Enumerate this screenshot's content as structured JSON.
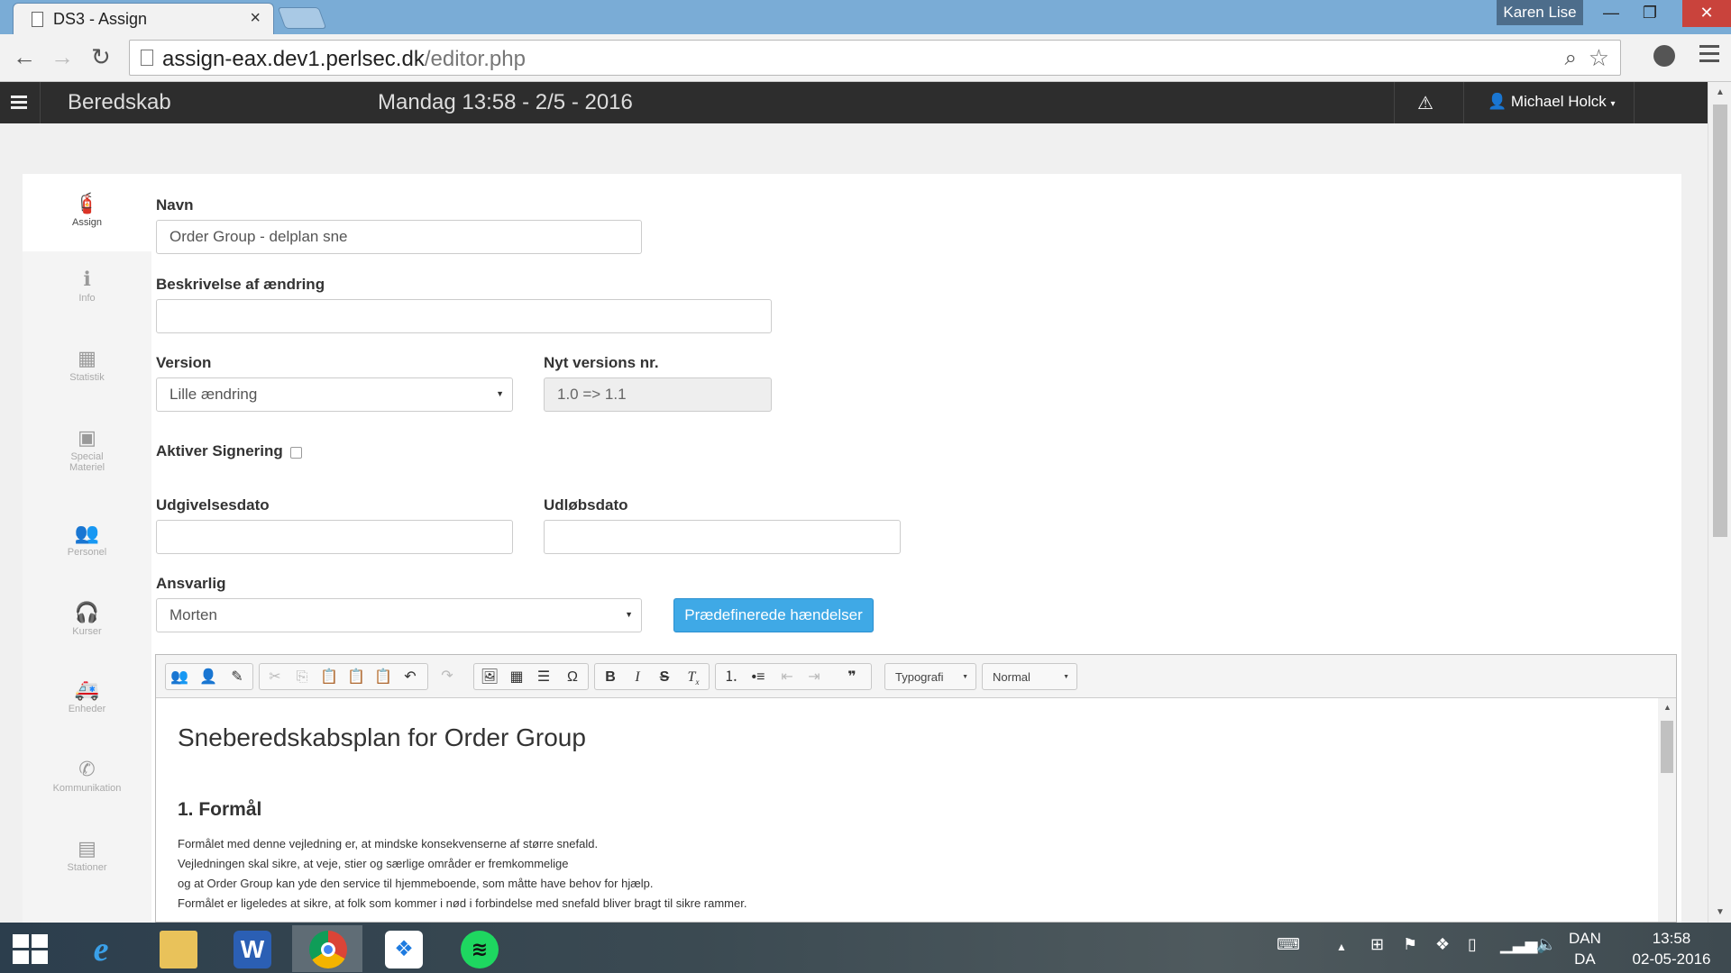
{
  "browser": {
    "tab_title": "DS3 - Assign",
    "tab_close": "×",
    "profile_name": "Karen Lise",
    "url_host": "assign-eax.dev1.perlsec.dk",
    "url_path": "/editor.php"
  },
  "appbar": {
    "brand": "Beredskab",
    "datetime": "Mandag 13:58 - 2/5 - 2016",
    "user": "Michael Holck"
  },
  "sidebar": {
    "items": [
      {
        "label": "Assign",
        "icon": "fire-extinguisher-icon",
        "glyph": "🧯"
      },
      {
        "label": "Info",
        "icon": "info-icon",
        "glyph": "ℹ"
      },
      {
        "label": "Statistik",
        "icon": "calendar-icon",
        "glyph": "▦"
      },
      {
        "label": "Special",
        "label2": "Materiel",
        "icon": "briefcase-icon",
        "glyph": "▣"
      },
      {
        "label": "Personel",
        "icon": "users-icon",
        "glyph": "👥"
      },
      {
        "label": "Kurser",
        "icon": "headset-icon",
        "glyph": "🎧"
      },
      {
        "label": "Enheder",
        "icon": "ambulance-icon",
        "glyph": "🚑"
      },
      {
        "label": "Kommunikation",
        "icon": "phone-icon",
        "glyph": "✆"
      },
      {
        "label": "Stationer",
        "icon": "building-icon",
        "glyph": "▤"
      }
    ]
  },
  "form": {
    "name_label": "Navn",
    "name_value": "Order Group - delplan sne",
    "desc_label": "Beskrivelse af ændring",
    "desc_value": "",
    "version_label": "Version",
    "version_value": "Lille ændring",
    "new_version_label": "Nyt versions nr.",
    "new_version_value": "1.0 => 1.1",
    "signing_label": "Aktiver Signering",
    "signing_checked": false,
    "release_label": "Udgivelsesdato",
    "release_value": "",
    "expiry_label": "Udløbsdato",
    "expiry_value": "",
    "responsible_label": "Ansvarlig",
    "responsible_value": "Morten",
    "predefined_button": "Prædefinerede hændelser"
  },
  "editor": {
    "format_combo": "Typografi",
    "style_combo": "Normal",
    "heading": "Snеberedskabsplan for Order Group",
    "section_title": "1. Formål",
    "paragraph_lines": [
      "Formålet med denne vejledning er, at mindske konsekvenserne af større snefald.",
      "Vejledningen skal sikre, at veje, stier og særlige områder er fremkommelige",
      "og at Order Group kan yde den service til hjemmeboende, som måtte have behov for hjælp.",
      "Formålet er ligeledes at sikre, at folk som kommer i nød i forbindelse med snefald bliver bragt til sikre rammer."
    ]
  },
  "taskbar": {
    "lang_top": "DAN",
    "lang_bottom": "DA",
    "time": "13:58",
    "date": "02-05-2016"
  },
  "colors": {
    "accent": "#3fa9e6",
    "navbar": "#2d2d2d",
    "tabstrip": "#7aacd6"
  }
}
